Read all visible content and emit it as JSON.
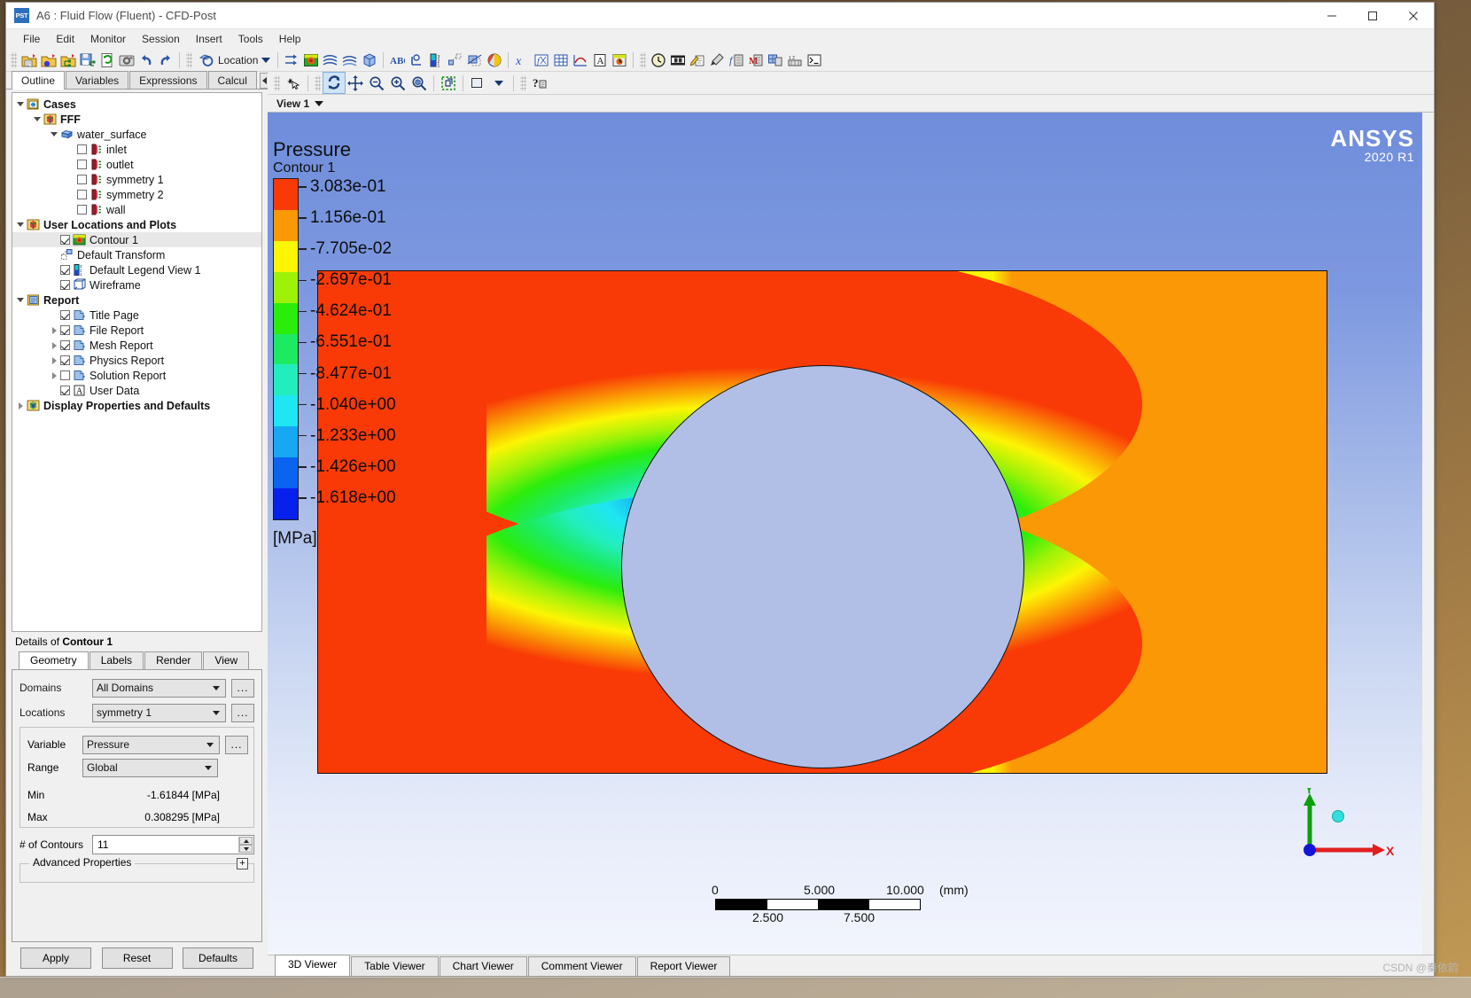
{
  "window": {
    "app_badge": "PST",
    "title": "A6 : Fluid Flow (Fluent) - CFD-Post",
    "minimize": "—",
    "maximize": "☐",
    "close": "✕"
  },
  "menubar": [
    "File",
    "Edit",
    "Monitor",
    "Session",
    "Insert",
    "Tools",
    "Help"
  ],
  "toolbar": {
    "location_label": "Location",
    "icons": [
      "load-results-icon",
      "load-results-particle-icon",
      "load-results-mesh-icon",
      "save-state-icon",
      "refresh-icon",
      "snapshot-icon",
      "undo-icon",
      "redo-icon",
      "location-icon",
      "vector-icon",
      "contour-icon",
      "streamline-icon",
      "streamline-anim-icon",
      "volume-render-icon",
      "text-icon",
      "coordinate-frame-icon",
      "legend-icon",
      "instance-transform-icon",
      "clip-plane-icon",
      "color-map-icon",
      "expression-icon",
      "variable-icon",
      "table-icon",
      "chart-icon",
      "text-annotation-icon",
      "report-icon",
      "timestep-icon",
      "animation-icon",
      "edit-icon",
      "probe-icon",
      "function-calculator-icon",
      "macro-icon",
      "mesh-calculator-icon",
      "turbo-icon",
      "command-editor-icon"
    ]
  },
  "left_tabs": {
    "items": [
      "Outline",
      "Variables",
      "Expressions",
      "Calcul"
    ],
    "active": "Outline"
  },
  "tree": [
    {
      "label": "Cases",
      "level": 0,
      "bold": true,
      "expander": "down",
      "checkbox": "none",
      "icon": "cases-icon"
    },
    {
      "label": "FFF",
      "level": 1,
      "bold": true,
      "expander": "down",
      "checkbox": "none",
      "icon": "case-icon"
    },
    {
      "label": "water_surface",
      "level": 2,
      "bold": false,
      "expander": "down",
      "checkbox": "none",
      "icon": "assembly-icon"
    },
    {
      "label": "inlet",
      "level": 3,
      "bold": false,
      "expander": "none",
      "checkbox": "off",
      "icon": "boundary-icon"
    },
    {
      "label": "outlet",
      "level": 3,
      "bold": false,
      "expander": "none",
      "checkbox": "off",
      "icon": "boundary-icon"
    },
    {
      "label": "symmetry 1",
      "level": 3,
      "bold": false,
      "expander": "none",
      "checkbox": "off",
      "icon": "boundary-icon"
    },
    {
      "label": "symmetry 2",
      "level": 3,
      "bold": false,
      "expander": "none",
      "checkbox": "off",
      "icon": "boundary-icon"
    },
    {
      "label": "wall",
      "level": 3,
      "bold": false,
      "expander": "none",
      "checkbox": "off",
      "icon": "boundary-icon"
    },
    {
      "label": "User Locations and Plots",
      "level": 0,
      "bold": true,
      "expander": "down",
      "checkbox": "none",
      "icon": "user-locations-icon"
    },
    {
      "label": "Contour 1",
      "level": 2,
      "bold": false,
      "expander": "none",
      "checkbox": "on",
      "icon": "contour-icon",
      "selected": true
    },
    {
      "label": "Default Transform",
      "level": 2,
      "bold": false,
      "expander": "none",
      "checkbox": "none",
      "icon": "transform-icon"
    },
    {
      "label": "Default Legend View 1",
      "level": 2,
      "bold": false,
      "expander": "none",
      "checkbox": "on",
      "icon": "legend-icon"
    },
    {
      "label": "Wireframe",
      "level": 2,
      "bold": false,
      "expander": "none",
      "checkbox": "on",
      "icon": "wireframe-icon"
    },
    {
      "label": "Report",
      "level": 0,
      "bold": true,
      "expander": "down",
      "checkbox": "none",
      "icon": "report-icon"
    },
    {
      "label": "Title Page",
      "level": 2,
      "bold": false,
      "expander": "none",
      "checkbox": "on",
      "icon": "page-icon"
    },
    {
      "label": "File Report",
      "level": 2,
      "bold": false,
      "expander": "right",
      "checkbox": "on",
      "icon": "page-icon"
    },
    {
      "label": "Mesh Report",
      "level": 2,
      "bold": false,
      "expander": "right",
      "checkbox": "on",
      "icon": "page-icon"
    },
    {
      "label": "Physics Report",
      "level": 2,
      "bold": false,
      "expander": "right",
      "checkbox": "on",
      "icon": "page-icon"
    },
    {
      "label": "Solution Report",
      "level": 2,
      "bold": false,
      "expander": "right",
      "checkbox": "off",
      "icon": "page-icon"
    },
    {
      "label": "User Data",
      "level": 2,
      "bold": false,
      "expander": "none",
      "checkbox": "on",
      "icon": "user-data-icon"
    },
    {
      "label": "Display Properties and Defaults",
      "level": 0,
      "bold": true,
      "expander": "right",
      "checkbox": "none",
      "icon": "display-props-icon"
    }
  ],
  "details": {
    "title_prefix": "Details of ",
    "title_object": "Contour 1",
    "tabs": [
      "Geometry",
      "Labels",
      "Render",
      "View"
    ],
    "active_tab": "Geometry",
    "fields": {
      "domains_label": "Domains",
      "domains_value": "All Domains",
      "locations_label": "Locations",
      "locations_value": "symmetry 1",
      "variable_label": "Variable",
      "variable_value": "Pressure",
      "range_label": "Range",
      "range_value": "Global",
      "min_label": "Min",
      "min_value": "-1.61844 [MPa]",
      "max_label": "Max",
      "max_value": "0.308295 [MPa]",
      "contours_label": "# of Contours",
      "contours_value": "11",
      "advanced_label": "Advanced Properties",
      "advanced_expand": "+",
      "ellipsis": "..."
    },
    "buttons": {
      "apply": "Apply",
      "reset": "Reset",
      "defaults": "Defaults"
    }
  },
  "viewer": {
    "view_tab": "View 1",
    "brand": {
      "line1": "ANSYS",
      "line2": "2020 R1"
    },
    "toolbar_icons": [
      "pick-icon",
      "rotate-icon",
      "pan-icon",
      "zoom-box-icon",
      "zoom-in-icon",
      "fit-view-icon",
      "toggle-bounding-icon",
      "view-preset-icon",
      "help-icon"
    ],
    "legend": {
      "title": "Pressure",
      "subtitle": "Contour 1",
      "units": "[MPa]",
      "ticks": [
        "3.083e-01",
        "1.156e-01",
        "-7.705e-02",
        "-2.697e-01",
        "-4.624e-01",
        "-6.551e-01",
        "-8.477e-01",
        "-1.040e+00",
        "-1.233e+00",
        "-1.426e+00",
        "-1.618e+00"
      ],
      "colors": [
        "#f93a06",
        "#fb9805",
        "#fcf504",
        "#9ef208",
        "#2bed0c",
        "#1ceb62",
        "#22eebd",
        "#1ee6f2",
        "#17a8f3",
        "#0a64f0",
        "#0820ec"
      ]
    },
    "scale_bar": {
      "top_labels": [
        "0",
        "5.000",
        "10.000"
      ],
      "bottom_labels": [
        "2.500",
        "7.500"
      ],
      "units": "(mm)"
    },
    "triad": {
      "x_label": "X",
      "y_label": "Y"
    }
  },
  "chart_data": {
    "type": "heatmap",
    "title": "Pressure Contour 1",
    "units": "MPa",
    "variable": "Pressure",
    "location": "symmetry 1",
    "num_contours": 11,
    "range_mode": "Global",
    "min": -1.61844,
    "max": 0.308295,
    "legend_levels": [
      0.3083,
      0.1156,
      -0.07705,
      -0.2697,
      -0.4624,
      -0.6551,
      -0.8477,
      -1.04,
      -1.233,
      -1.426,
      -1.618
    ],
    "legend_colors": [
      "#f93a06",
      "#fb9805",
      "#fcf504",
      "#9ef208",
      "#2bed0c",
      "#1ceb62",
      "#22eebd",
      "#1ee6f2",
      "#17a8f3",
      "#0a64f0",
      "#0820ec"
    ],
    "scale_ticks_mm": [
      0,
      2.5,
      5.0,
      7.5,
      10.0
    ],
    "description": "2D pressure contour on symmetry plane of flow past a circular cylinder; high pressure (red) upstream-left, low pressure (blue) at cylinder crown, recovery to yellow/orange downstream-right."
  },
  "bottom_tabs": {
    "items": [
      "3D Viewer",
      "Table Viewer",
      "Chart Viewer",
      "Comment Viewer",
      "Report Viewer"
    ],
    "active": "3D Viewer"
  },
  "watermark": "CSDN @秦依韵"
}
